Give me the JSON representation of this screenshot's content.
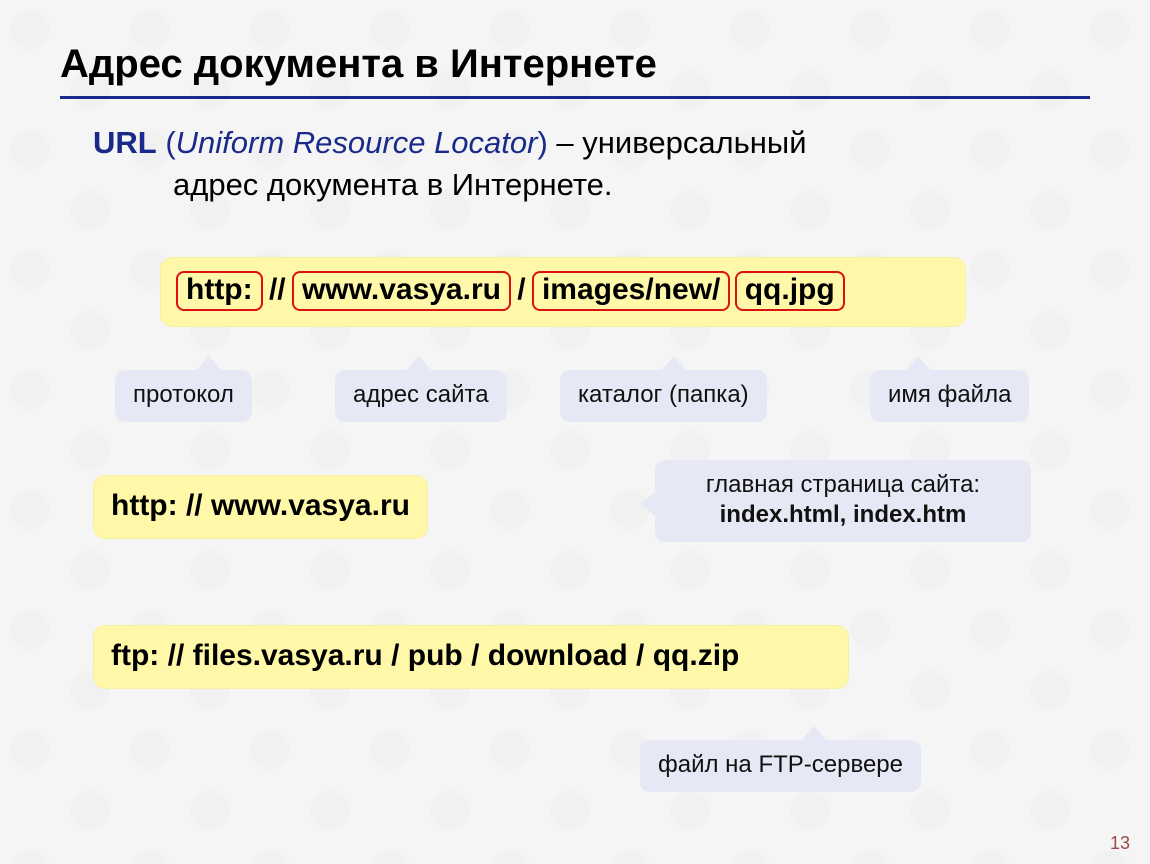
{
  "title": "Адрес документа в Интернете",
  "definition": {
    "url_label": "URL",
    "open_paren": " (",
    "expansion": "Uniform Resource Locator",
    "close_paren": ")",
    "dash_text": " – универсальный",
    "line2": "адрес документа в Интернете."
  },
  "url_breakdown": {
    "proto": "http:",
    "sep1": " // ",
    "host": "www.vasya.ru",
    "sep2": " / ",
    "dir": "images/new/",
    "sep3": " ",
    "file": "qq.jpg"
  },
  "labels": {
    "proto": "протокол",
    "host": "адрес сайта",
    "dir": "каталог (папка)",
    "file": "имя файла"
  },
  "example2": "http: // www.vasya.ru",
  "homepage_note": {
    "line1": "главная страница сайта:",
    "line2": "index.html, index.htm"
  },
  "example3": "ftp: // files.vasya.ru / pub / download / qq.zip",
  "ftp_note": "файл на FTP-сервере",
  "page_number": "13"
}
